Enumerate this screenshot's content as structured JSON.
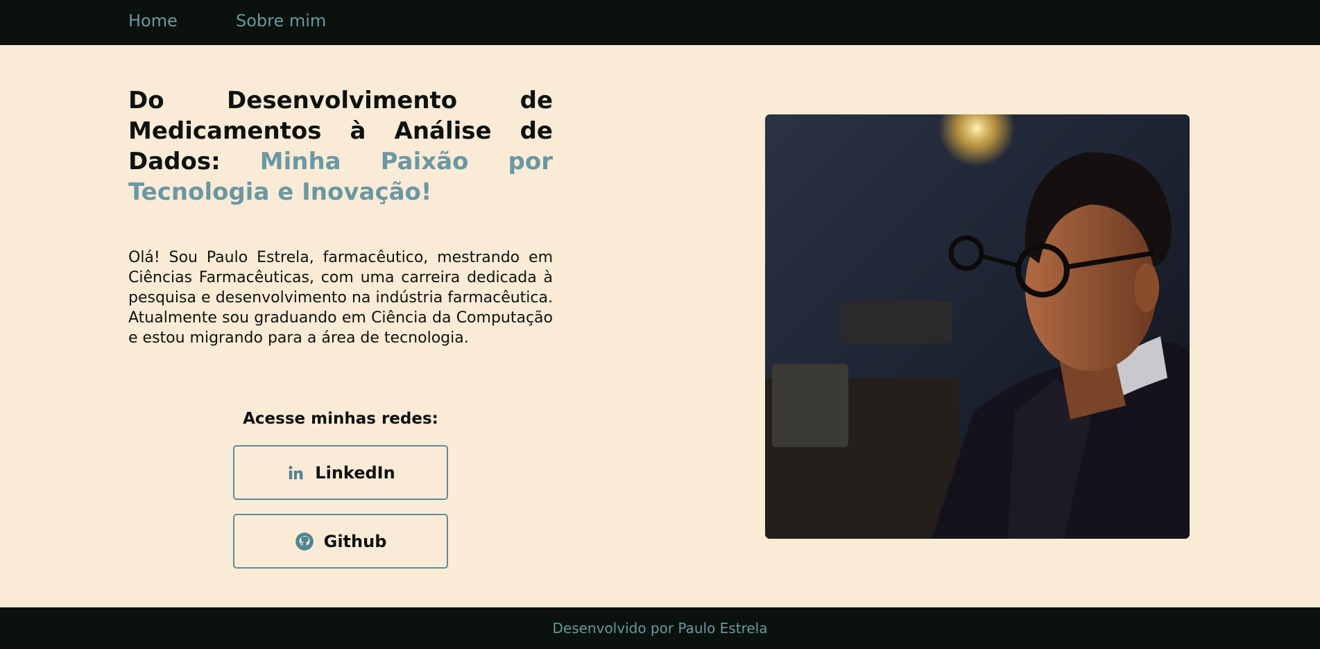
{
  "nav": {
    "home": "Home",
    "about": "Sobre mim"
  },
  "hero": {
    "headline_lead": "Do Desenvolvimento de Medicamentos à Análise de Dados:",
    "headline_accent": "Minha Paixão por Tecnologia e Inovação!",
    "intro": "Olá! Sou Paulo Estrela, farmacêutico, mestrando em Ciências Farmacêuticas, com uma carreira dedicada à pesquisa e desenvolvimento na indústria farmacêutica. Atualmente sou graduando em Ciência da Computação e estou migrando para a área de tecnologia."
  },
  "social": {
    "title": "Acesse minhas redes:",
    "linkedin": {
      "label": "LinkedIn",
      "icon": "linkedin-icon"
    },
    "github": {
      "label": "Github",
      "icon": "github-icon"
    }
  },
  "photo": {
    "alt": "Paulo Estrela"
  },
  "footer": {
    "text": "Desenvolvido por Paulo Estrela"
  },
  "colors": {
    "background": "#faebd7",
    "dark": "#0b110d",
    "accent": "#6a98a2",
    "button_border": "#5f8c96"
  }
}
